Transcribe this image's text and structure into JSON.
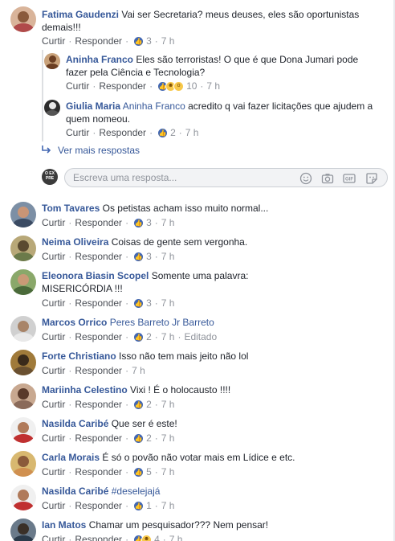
{
  "actions": {
    "like": "Curtir",
    "reply": "Responder",
    "sep": "·"
  },
  "thread": {
    "main": {
      "name": "Fatima Gaudenzi",
      "text_line1": "Vai ser Secretaria? meus deuses, eles são oportunistas",
      "text_line2": "demais!!!",
      "reactions": "3",
      "time": "7 h"
    },
    "replies": [
      {
        "name": "Aninha Franco",
        "text_line1": "Eles são terroristas! O que é que Dona Jumari pode",
        "text_line2": "fazer pela Ciência e Tecnologia?",
        "reactions": "10",
        "time": "7 h"
      },
      {
        "name": "Giulia Maria",
        "mention": "Aninha Franco",
        "text_line1": "acredito q vai fazer licitações que ajudem a",
        "text_line2": "quem nomeou.",
        "reactions": "2",
        "time": "7 h"
      }
    ],
    "more_replies": "Ver mais respostas",
    "reply_avatar_text": "O EX PRE",
    "reply_placeholder": "Escreva uma resposta..."
  },
  "comments": [
    {
      "name": "Tom Tavares",
      "text": "Os petistas acham isso muito normal...",
      "reactions": "3",
      "time": "7 h"
    },
    {
      "name": "Neima Oliveira",
      "text": "Coisas de gente sem vergonha.",
      "reactions": "3",
      "time": "7 h"
    },
    {
      "name": "Eleonora Biasin Scopel",
      "text": "Somente uma palavra:",
      "text_line2": "MISERICÓRDIA !!!",
      "reactions": "3",
      "time": "7 h"
    },
    {
      "name": "Marcos Orrico",
      "mention": "Peres Barreto Jr Barreto",
      "reactions": "2",
      "time": "7 h",
      "edited": "Editado"
    },
    {
      "name": "Forte Christiano",
      "text": "Isso não tem mais jeito não lol",
      "time": "7 h"
    },
    {
      "name": "Mariinha Celestino",
      "text": "Vixi ! É o holocausto !!!!",
      "reactions": "2",
      "time": "7 h"
    },
    {
      "name": "Nasilda Caribé",
      "text": "Que ser é este!",
      "reactions": "2",
      "time": "7 h"
    },
    {
      "name": "Carla Morais",
      "text": "É só o povão não votar mais em Lídice e etc.",
      "reactions": "5",
      "time": "7 h"
    },
    {
      "name": "Nasilda Caribé",
      "text": "#deselejajá",
      "reactions": "1",
      "time": "7 h"
    },
    {
      "name": "Ian Matos",
      "text": "Chamar um pesquisador??? Nem pensar!",
      "reactions": "4",
      "time": "7 h"
    }
  ],
  "icons": {
    "like": "thumbs-up-icon",
    "reply_arrow": "reply-arrow-icon",
    "emoji": "emoji-icon",
    "camera": "camera-icon",
    "gif": "gif-icon",
    "sticker": "sticker-icon"
  },
  "colors": {
    "name": "#365899",
    "text": "#1d2129",
    "meta": "#90949c",
    "like": "#4267b2",
    "input_bg": "#f2f3f5"
  }
}
